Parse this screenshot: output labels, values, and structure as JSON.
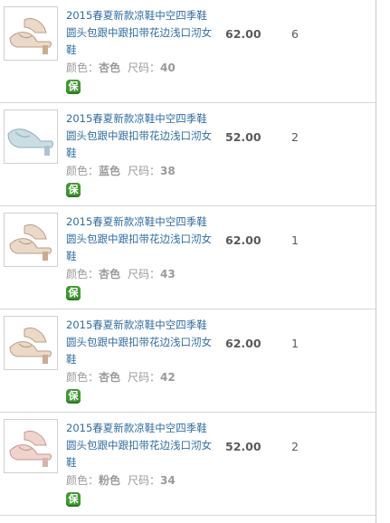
{
  "items": [
    {
      "title": "2015春夏新款凉鞋中空四季鞋圆头包跟中跟扣带花边浅口沏女鞋",
      "color_label": "颜色：",
      "color": "杏色",
      "size_label": "尺码：",
      "size": "40",
      "price": "62.00",
      "qty": "6",
      "badge": "保",
      "thumb_color": "#ead9c7"
    },
    {
      "title": "2015春夏新款凉鞋中空四季鞋圆头包跟中跟扣带花边浅口沏女鞋",
      "color_label": "颜色：",
      "color": "蓝色",
      "size_label": "尺码：",
      "size": "38",
      "price": "52.00",
      "qty": "2",
      "badge": "保",
      "thumb_color": "#c9dde3"
    },
    {
      "title": "2015春夏新款凉鞋中空四季鞋圆头包跟中跟扣带花边浅口沏女鞋",
      "color_label": "颜色：",
      "color": "杏色",
      "size_label": "尺码：",
      "size": "43",
      "price": "62.00",
      "qty": "1",
      "badge": "保",
      "thumb_color": "#ead9c7"
    },
    {
      "title": "2015春夏新款凉鞋中空四季鞋圆头包跟中跟扣带花边浅口沏女鞋",
      "color_label": "颜色：",
      "color": "杏色",
      "size_label": "尺码：",
      "size": "42",
      "price": "62.00",
      "qty": "1",
      "badge": "保",
      "thumb_color": "#ead9c7"
    },
    {
      "title": "2015春夏新款凉鞋中空四季鞋圆头包跟中跟扣带花边浅口沏女鞋",
      "color_label": "颜色：",
      "color": "粉色",
      "size_label": "尺码：",
      "size": "34",
      "price": "52.00",
      "qty": "2",
      "badge": "保",
      "thumb_color": "#efd3cc"
    }
  ]
}
